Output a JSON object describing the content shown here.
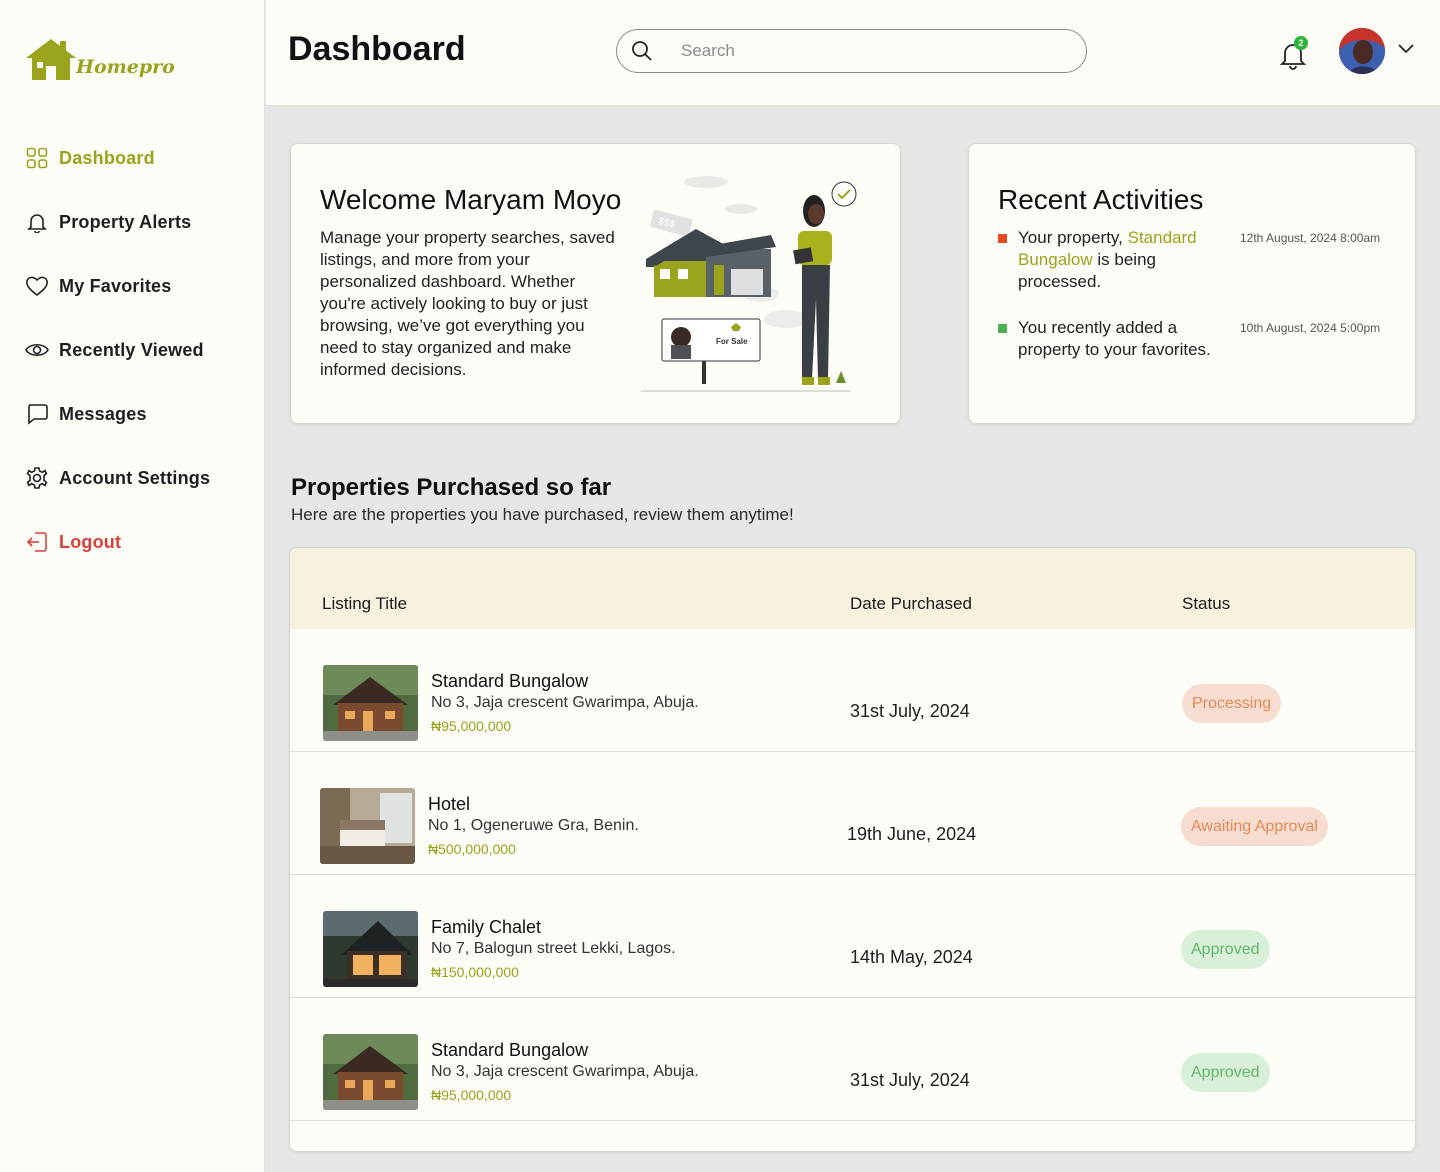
{
  "brand": {
    "name": "Homepro",
    "color": "#9aa31c"
  },
  "sidebar": {
    "items": [
      {
        "label": "Dashboard",
        "icon": "grid-icon",
        "active": true
      },
      {
        "label": "Property Alerts",
        "icon": "bell-icon"
      },
      {
        "label": "My Favorites",
        "icon": "heart-icon"
      },
      {
        "label": "Recently Viewed",
        "icon": "eye-icon"
      },
      {
        "label": "Messages",
        "icon": "chat-icon"
      },
      {
        "label": "Account Settings",
        "icon": "gear-icon"
      },
      {
        "label": "Logout",
        "icon": "logout-icon"
      }
    ]
  },
  "header": {
    "title": "Dashboard",
    "search_placeholder": "Search",
    "notification_count": "2"
  },
  "welcome": {
    "title": "Welcome Maryam Moyo",
    "body": "Manage your property searches, saved listings, and more from your personalized dashboard. Whether you're actively looking to buy or just browsing, we’ve got everything you need to stay organized and make informed decisions.",
    "sign_label": "For Sale",
    "tag_label": "$$$"
  },
  "activities": {
    "title": "Recent Activities",
    "items": [
      {
        "text_before": "Your property, ",
        "highlight": "Standard Bungalow",
        "text_after": " is being processed.",
        "time": "12th August, 2024 8:00am",
        "color": "#e8491d"
      },
      {
        "text_before": "You recently added a property to your favorites.",
        "highlight": "",
        "text_after": "",
        "time": "10th August, 2024 5:00pm",
        "color": "#4caf50"
      }
    ]
  },
  "purchases": {
    "title": "Properties Purchased so far",
    "subtitle": "Here are the properties you have purchased, review them anytime!",
    "columns": [
      "Listing Title",
      "Date Purchased",
      "Status"
    ],
    "rows": [
      {
        "title": "Standard Bungalow",
        "address": "No 3, Jaja crescent Gwarimpa, Abuja.",
        "price": "₦95,000,000",
        "date": "31st July, 2024",
        "status": "Processing",
        "status_type": "processing",
        "thumb": "cabin"
      },
      {
        "title": "Hotel",
        "address": "No 1, Ogeneruwe Gra, Benin.",
        "price": "₦500,000,000",
        "date": "19th June, 2024",
        "status": "Awaiting Approval",
        "status_type": "awaiting",
        "thumb": "room"
      },
      {
        "title": "Family Chalet",
        "address": "No 7, Balogun street Lekki, Lagos.",
        "price": "₦150,000,000",
        "date": "14th May, 2024",
        "status": "Approved",
        "status_type": "approved",
        "thumb": "chalet"
      },
      {
        "title": "Standard Bungalow",
        "address": "No 3, Jaja crescent Gwarimpa, Abuja.",
        "price": "₦95,000,000",
        "date": "31st July, 2024",
        "status": "Approved",
        "status_type": "approved",
        "thumb": "cabin"
      }
    ]
  }
}
